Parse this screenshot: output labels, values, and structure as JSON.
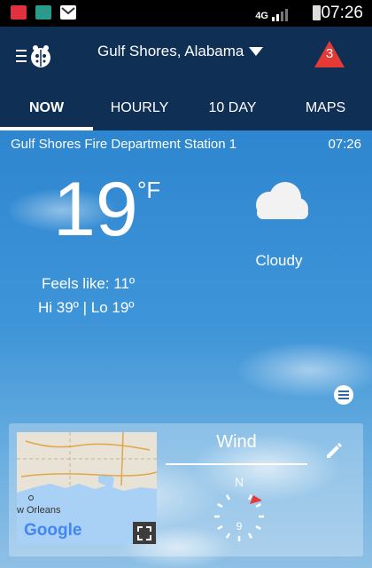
{
  "status_bar": {
    "time": "07:26",
    "network": "4G"
  },
  "header": {
    "location": "Gulf Shores, Alabama",
    "alert_count": "3"
  },
  "tabs": [
    {
      "label": "NOW"
    },
    {
      "label": "HOURLY"
    },
    {
      "label": "10 DAY"
    },
    {
      "label": "MAPS"
    }
  ],
  "observation": {
    "station": "Gulf Shores Fire Department  Station 1",
    "time": "07:26",
    "temperature": "19",
    "unit": "°F",
    "condition": "Cloudy",
    "feels_like": "Feels like: 11º",
    "hi_lo": "Hi 39º | Lo 19º"
  },
  "card": {
    "map_city": "w Orleans",
    "map_logo": "Google",
    "wind_title": "Wind",
    "wind_direction": "N",
    "wind_speed": "9"
  },
  "colors": {
    "header_bg": "#0f2f55",
    "alert": "#e53935",
    "sky": "#3f95d8"
  }
}
